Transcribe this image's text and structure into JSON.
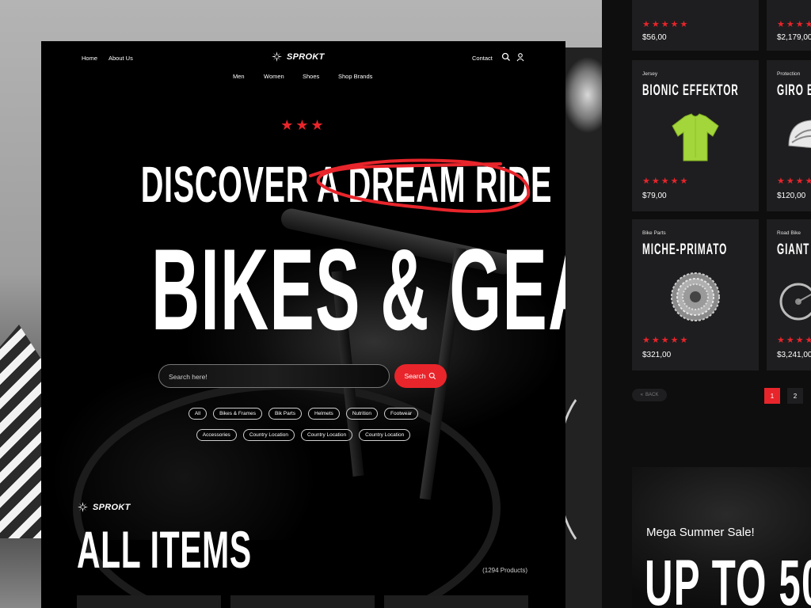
{
  "brand": {
    "name": "SPROKT",
    "accent": "#e8252b"
  },
  "nav": {
    "home": "Home",
    "about": "About Us",
    "contact": "Contact"
  },
  "categories": [
    "Men",
    "Women",
    "Shoes",
    "Shop Brands"
  ],
  "hero": {
    "stars": "★★★",
    "line1": "DISCOVER A DREAM RIDE",
    "line2": "BIKES & GEAR"
  },
  "search": {
    "placeholder": "Search here!",
    "button": "Search"
  },
  "filters": {
    "row1": [
      "All",
      "Bikes & Frames",
      "Bik Parts",
      "Helmets",
      "Nutrition",
      "Footwear"
    ],
    "row2": [
      "Accessories",
      "Country Location",
      "Country Location",
      "Country Location"
    ]
  },
  "listing": {
    "title": "ALL ITEMS",
    "count": "(1294 Products)"
  },
  "products": [
    {
      "category": "",
      "name": "",
      "stars": "★★★★★",
      "price": "$56,00"
    },
    {
      "category": "",
      "name": "",
      "stars": "★★★★★",
      "price": "$2,179,00"
    },
    {
      "category": "Jersey",
      "name": "BIONIC EFFEKTOR",
      "stars": "★★★★★",
      "price": "$79,00",
      "icon": "jersey-icon"
    },
    {
      "category": "Protection",
      "name": "GIRO E",
      "stars": "★★★★★",
      "price": "$120,00",
      "icon": "helmet-icon"
    },
    {
      "category": "Bike Parts",
      "name": "MICHE-PRIMATO",
      "stars": "★★★★★",
      "price": "$321,00",
      "icon": "cassette-icon"
    },
    {
      "category": "Road Bike",
      "name": "GIANT",
      "stars": "★★★★★",
      "price": "$3,241,00",
      "icon": "bike-icon"
    }
  ],
  "pagination": {
    "back": "BACK",
    "pages": [
      "1",
      "2"
    ],
    "active": "1"
  },
  "sale": {
    "small": "Mega Summer Sale!",
    "big": "UP TO 50"
  }
}
